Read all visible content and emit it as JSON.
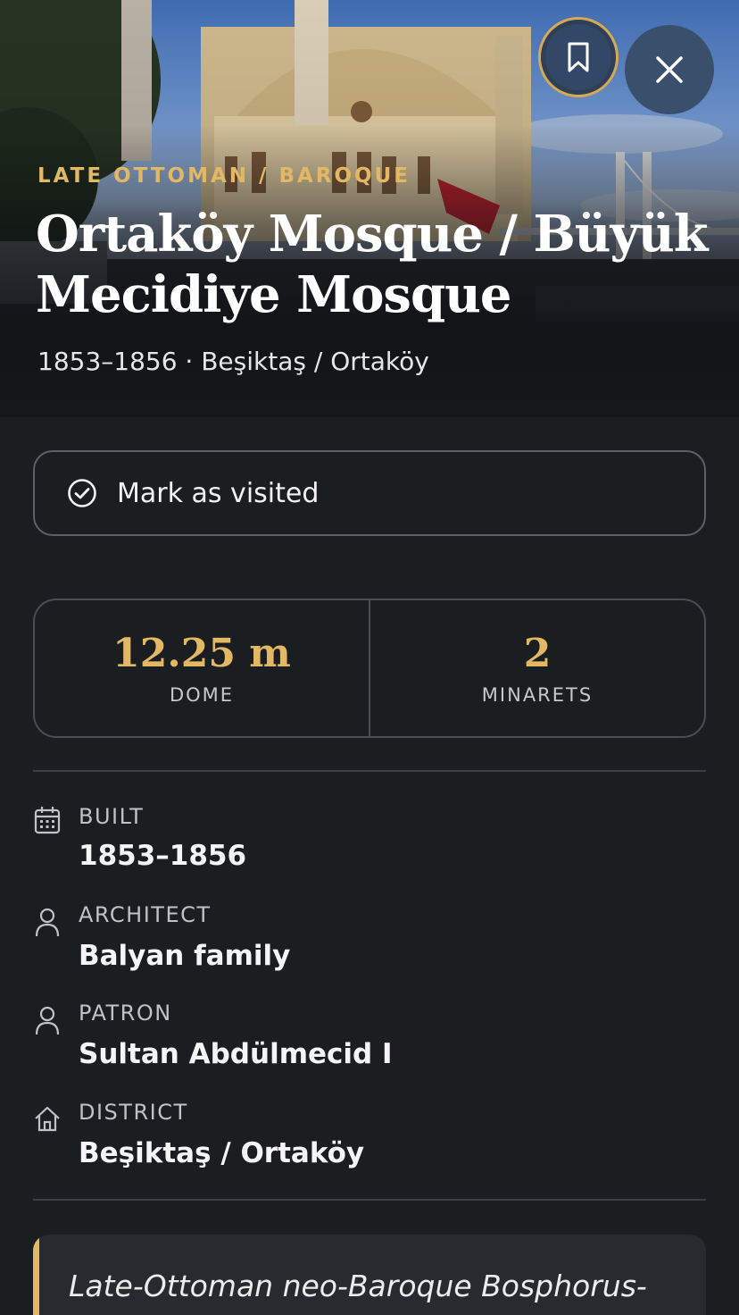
{
  "hero": {
    "style_tag": "LATE OTTOMAN / BAROQUE",
    "title": "Ortaköy Mosque / Büyük Mecidiye Mosque",
    "subtitle": "1853–1856 · Beşiktaş / Ortaköy"
  },
  "actions": {
    "bookmark_icon": "bookmark-icon",
    "close_icon": "close-icon"
  },
  "visited": {
    "label": "Mark as visited",
    "icon": "check-circle-icon"
  },
  "stats": [
    {
      "value": "12.25 m",
      "caption": "DOME"
    },
    {
      "value": "2",
      "caption": "MINARETS"
    }
  ],
  "details": [
    {
      "label": "BUILT",
      "value": "1853–1856",
      "icon": "calendar-icon"
    },
    {
      "label": "ARCHITECT",
      "value": "Balyan family",
      "icon": "person-icon"
    },
    {
      "label": "PATRON",
      "value": "Sultan Abdülmecid I",
      "icon": "person-icon"
    },
    {
      "label": "DISTRICT",
      "value": "Beşiktaş / Ortaköy",
      "icon": "home-icon"
    }
  ],
  "quote": {
    "text": "Late-Ottoman neo-Baroque Bosphorus-"
  },
  "colors": {
    "accent": "#e3b865",
    "background": "#1b1e21"
  }
}
